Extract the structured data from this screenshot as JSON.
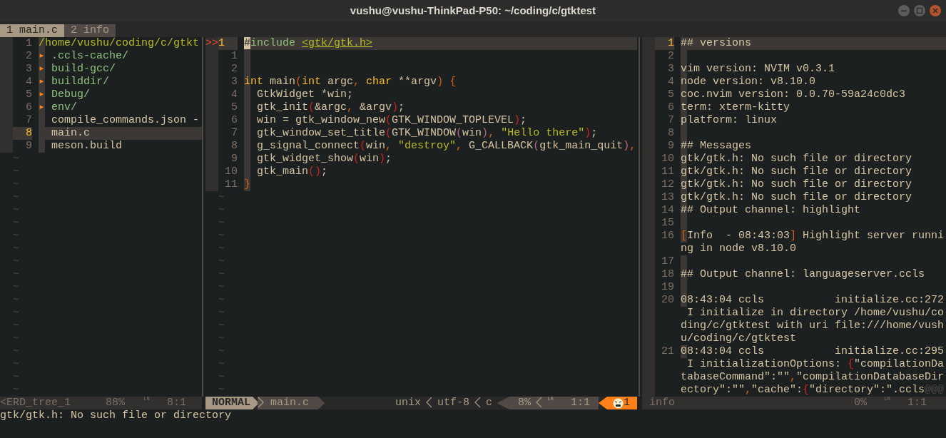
{
  "window": {
    "title": "vushu@vushu-ThinkPad-P50: ~/coding/c/gtktest"
  },
  "tabline": [
    {
      "label": "1 main.c",
      "selected": true
    },
    {
      "label": "2 info",
      "selected": false
    }
  ],
  "tree_pane": {
    "lines": [
      {
        "number": "1",
        "kind": "root",
        "text": "/home/vushu/coding/c/gtkt",
        "selected": false
      },
      {
        "number": "2",
        "kind": "dir",
        "arrow": "▸",
        "text": ".ccls-cache/",
        "selected": false
      },
      {
        "number": "3",
        "kind": "dir",
        "arrow": "▸",
        "text": "build-gcc/",
        "selected": false
      },
      {
        "number": "4",
        "kind": "dir",
        "arrow": "▸",
        "text": "builddir/",
        "selected": false
      },
      {
        "number": "5",
        "kind": "dir",
        "arrow": "▸",
        "text": "Debug/",
        "selected": false
      },
      {
        "number": "6",
        "kind": "dir",
        "arrow": "▸",
        "text": "env/",
        "selected": false
      },
      {
        "number": "7",
        "kind": "file",
        "text": "compile_commands.json -",
        "selected": false
      },
      {
        "number": "8",
        "kind": "file",
        "text": "main.c",
        "selected": true
      },
      {
        "number": "9",
        "kind": "file",
        "text": "meson.build",
        "selected": false
      }
    ],
    "filler": [
      "~",
      "~",
      "~",
      "~",
      "~",
      "~",
      "~",
      "~",
      "~",
      "~",
      "~",
      "~",
      "~",
      "~",
      "~",
      "~",
      "~",
      "~",
      "~"
    ],
    "status": {
      "name": "<ERD_tree_1",
      "percent": "88%",
      "ln_symbol": "LN",
      "position": "8:1"
    }
  },
  "editor_pane": {
    "lines": [
      {
        "sign": ">>",
        "number": "1",
        "current": true,
        "segments": [
          {
            "text": "#",
            "kind": "cursor"
          },
          {
            "text": "include ",
            "kind": "pre"
          },
          {
            "text": "<gtk/gtk.h>",
            "kind": "inc"
          }
        ]
      },
      {
        "number": "1",
        "current": false
      },
      {
        "number": "2",
        "current": false
      },
      {
        "number": "3",
        "current": false,
        "segments": [
          {
            "text": "int",
            "kind": "type"
          },
          {
            "text": " main",
            "kind": "plain"
          },
          {
            "text": "(",
            "kind": "paren1"
          },
          {
            "text": "int",
            "kind": "type"
          },
          {
            "text": " argc",
            "kind": "plain"
          },
          {
            "text": ", ",
            "kind": "punct"
          },
          {
            "text": "char",
            "kind": "type"
          },
          {
            "text": " **argv",
            "kind": "plain"
          },
          {
            "text": ") {",
            "kind": "paren1"
          }
        ]
      },
      {
        "number": "4",
        "current": false,
        "segments": [
          {
            "text": "  GtkWidget *win;",
            "kind": "plain"
          }
        ]
      },
      {
        "number": "5",
        "current": false,
        "segments": [
          {
            "text": "  gtk_init",
            "kind": "plain"
          },
          {
            "text": "(",
            "kind": "paren2"
          },
          {
            "text": "&argc",
            "kind": "plain"
          },
          {
            "text": ",",
            "kind": "punct"
          },
          {
            "text": " &argv",
            "kind": "plain"
          },
          {
            "text": ")",
            "kind": "paren2"
          },
          {
            "text": ";",
            "kind": "plain"
          }
        ]
      },
      {
        "number": "6",
        "current": false,
        "segments": [
          {
            "text": "  win = gtk_window_new",
            "kind": "plain"
          },
          {
            "text": "(",
            "kind": "paren2"
          },
          {
            "text": "GTK_WINDOW_TOPLEVEL",
            "kind": "plain"
          },
          {
            "text": ")",
            "kind": "paren2"
          },
          {
            "text": ";",
            "kind": "plain"
          }
        ]
      },
      {
        "number": "7",
        "current": false,
        "segments": [
          {
            "text": "  gtk_window_set_title",
            "kind": "plain"
          },
          {
            "text": "(",
            "kind": "paren2"
          },
          {
            "text": "GTK_WINDOW",
            "kind": "plain"
          },
          {
            "text": "(",
            "kind": "paren3"
          },
          {
            "text": "win",
            "kind": "plain"
          },
          {
            "text": ")",
            "kind": "paren3"
          },
          {
            "text": ", ",
            "kind": "punct"
          },
          {
            "text": "\"Hello there\"",
            "kind": "string"
          },
          {
            "text": ")",
            "kind": "paren2"
          },
          {
            "text": ";",
            "kind": "plain"
          }
        ]
      },
      {
        "number": "8",
        "current": false,
        "segments": [
          {
            "text": "  g_signal_connect",
            "kind": "plain"
          },
          {
            "text": "(",
            "kind": "paren2"
          },
          {
            "text": "win",
            "kind": "plain"
          },
          {
            "text": ", ",
            "kind": "punct"
          },
          {
            "text": "\"destroy\"",
            "kind": "string"
          },
          {
            "text": ",",
            "kind": "punct"
          },
          {
            "text": " G_CALLBACK",
            "kind": "plain"
          },
          {
            "text": "(",
            "kind": "paren3"
          },
          {
            "text": "gtk_main_quit",
            "kind": "plain"
          },
          {
            "text": ")",
            "kind": "paren3"
          },
          {
            "text": ",",
            "kind": "punct"
          }
        ]
      },
      {
        "number": "9",
        "current": false,
        "segments": [
          {
            "text": "  gtk_widget_show",
            "kind": "plain"
          },
          {
            "text": "(",
            "kind": "paren2"
          },
          {
            "text": "win",
            "kind": "plain"
          },
          {
            "text": ")",
            "kind": "paren2"
          },
          {
            "text": ";",
            "kind": "plain"
          }
        ]
      },
      {
        "number": "10",
        "current": false,
        "segments": [
          {
            "text": "  gtk_main",
            "kind": "plain"
          },
          {
            "text": "(",
            "kind": "paren2"
          },
          {
            "text": ")",
            "kind": "paren2"
          },
          {
            "text": ";",
            "kind": "plain"
          }
        ]
      },
      {
        "number": "11",
        "current": false,
        "segments": [
          {
            "text": "}",
            "kind": "paren1"
          }
        ]
      }
    ],
    "filler": [
      "~",
      "~",
      "~",
      "~",
      "~",
      "~",
      "~",
      "~",
      "~",
      "~",
      "~",
      "~",
      "~",
      "~",
      "~",
      "~"
    ],
    "status": {
      "mode": "NORMAL",
      "file": "main.c",
      "format": "unix",
      "encoding": "utf-8",
      "filetype": "c",
      "percent": "8%",
      "ln_symbol": "LN",
      "position": "1:1",
      "errors": "1"
    }
  },
  "info_pane": {
    "lines": [
      {
        "number": "1",
        "current": true,
        "segments": [
          {
            "text": "## versions",
            "kind": "plain"
          }
        ]
      },
      {
        "number": "2",
        "current": false
      },
      {
        "number": "3",
        "current": false,
        "segments": [
          {
            "text": "vim version: NVIM v0.3.1",
            "kind": "plain"
          }
        ]
      },
      {
        "number": "4",
        "current": false,
        "segments": [
          {
            "text": "node version: v8.10.0",
            "kind": "plain"
          }
        ]
      },
      {
        "number": "5",
        "current": false,
        "segments": [
          {
            "text": "coc.nvim version: 0.0.70-59a24c0dc3",
            "kind": "plain"
          }
        ]
      },
      {
        "number": "6",
        "current": false,
        "segments": [
          {
            "text": "term: xterm-kitty",
            "kind": "plain"
          }
        ]
      },
      {
        "number": "7",
        "current": false,
        "segments": [
          {
            "text": "platform: linux",
            "kind": "plain"
          }
        ]
      },
      {
        "number": "8",
        "current": false
      },
      {
        "number": "9",
        "current": false,
        "segments": [
          {
            "text": "## Messages",
            "kind": "plain"
          }
        ]
      },
      {
        "number": "10",
        "current": false,
        "segments": [
          {
            "text": "gtk/gtk.h: No such file or directory",
            "kind": "plain"
          }
        ]
      },
      {
        "number": "11",
        "current": false,
        "segments": [
          {
            "text": "gtk/gtk.h: No such file or directory",
            "kind": "plain"
          }
        ]
      },
      {
        "number": "12",
        "current": false,
        "segments": [
          {
            "text": "gtk/gtk.h: No such file or directory",
            "kind": "plain"
          }
        ]
      },
      {
        "number": "13",
        "current": false,
        "segments": [
          {
            "text": "gtk/gtk.h: No such file or directory",
            "kind": "plain"
          }
        ]
      },
      {
        "number": "14",
        "current": false,
        "segments": [
          {
            "text": "## Output channel: highlight",
            "kind": "plain"
          }
        ]
      },
      {
        "number": "15",
        "current": false
      },
      {
        "number": "16",
        "current": false,
        "segments": [
          {
            "text": "[",
            "kind": "punct"
          },
          {
            "text": "Info  - 08:43:03",
            "kind": "plain"
          },
          {
            "text": "]",
            "kind": "punct"
          },
          {
            "text": " Highlight server runni",
            "kind": "plain"
          }
        ]
      },
      {
        "segments": [
          {
            "text": "ng in node v8.10.0",
            "kind": "plain"
          }
        ]
      },
      {
        "number": "17",
        "current": false
      },
      {
        "number": "18",
        "current": false,
        "segments": [
          {
            "text": "## Output channel: languageserver.ccls",
            "kind": "plain"
          }
        ]
      },
      {
        "number": "19",
        "current": false
      },
      {
        "number": "20",
        "current": false,
        "segments": [
          {
            "text": "08:43:04 ccls           initialize.cc:272",
            "kind": "plain"
          }
        ]
      },
      {
        "segments": [
          {
            "text": " I initialize in directory /home/vushu/co",
            "kind": "plain"
          }
        ]
      },
      {
        "segments": [
          {
            "text": "ding/c/gtktest with uri file:///home/vush",
            "kind": "plain"
          }
        ]
      },
      {
        "segments": [
          {
            "text": "u/coding/c/gtktest",
            "kind": "plain"
          }
        ]
      },
      {
        "number": "21",
        "current": false,
        "segments": [
          {
            "text": "08:43:04 ccls           initialize.cc:295",
            "kind": "plain"
          }
        ]
      },
      {
        "segments": [
          {
            "text": " I initializationOptions: ",
            "kind": "plain"
          },
          {
            "text": "{",
            "kind": "paren2"
          },
          {
            "text": "\"compilationDa",
            "kind": "plain"
          }
        ]
      },
      {
        "segments": [
          {
            "text": "tabaseCommand\":\"\"",
            "kind": "plain"
          },
          {
            "text": ",",
            "kind": "punct"
          },
          {
            "text": "\"compilationDatabaseDir",
            "kind": "plain"
          }
        ]
      },
      {
        "segments": [
          {
            "text": "ectory\":\"\"",
            "kind": "plain"
          },
          {
            "text": ",",
            "kind": "punct"
          },
          {
            "text": "\"cache\":",
            "kind": "plain"
          },
          {
            "text": "{",
            "kind": "paren2"
          },
          {
            "text": "\"directory\":\".ccls",
            "kind": "plain"
          },
          {
            "text": "@@@",
            "kind": "dim"
          }
        ]
      }
    ],
    "status": {
      "name": "info",
      "percent": "0%",
      "ln_symbol": "LN",
      "position": "1:1"
    }
  },
  "command_line": {
    "message": "gtk/gtk.h: No such file or directory"
  }
}
